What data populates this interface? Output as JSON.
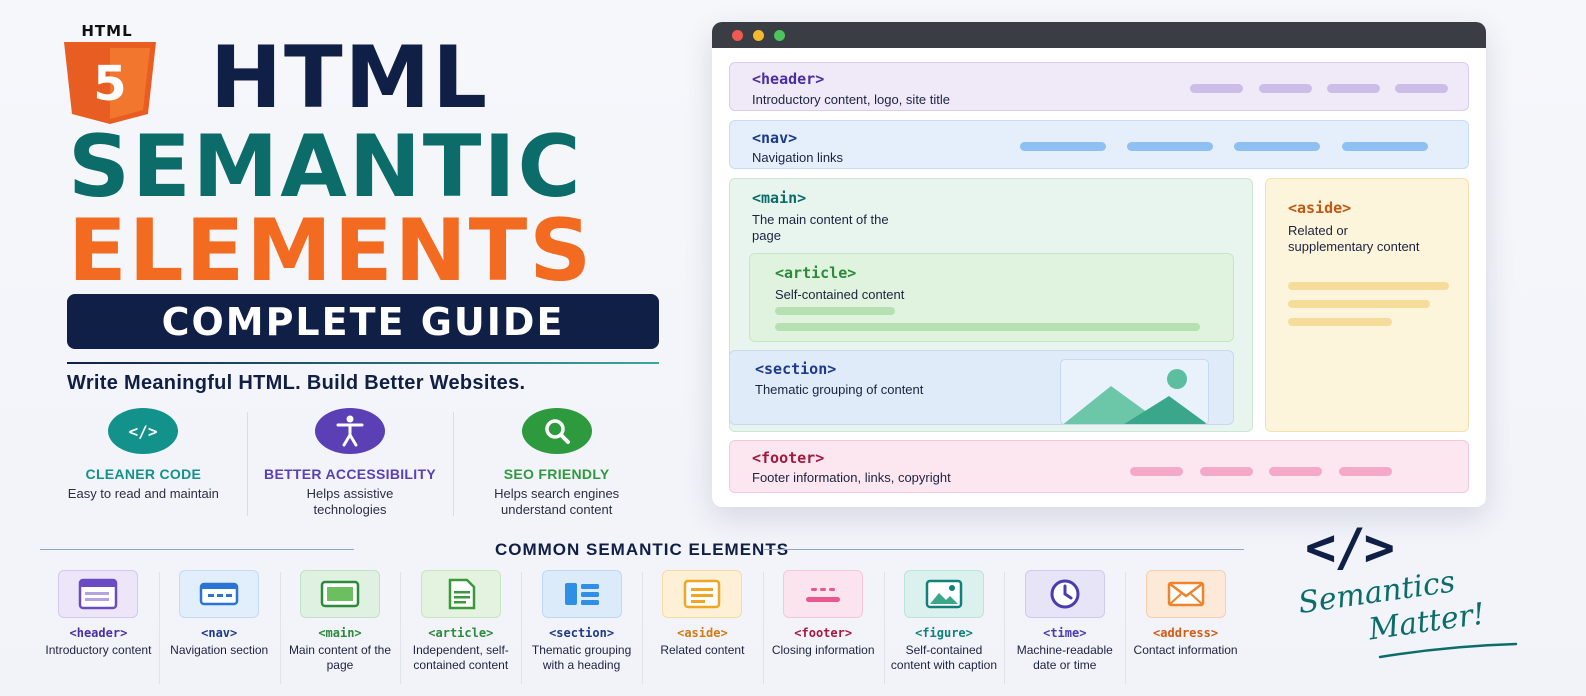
{
  "hero": {
    "logo_word": "HTML",
    "logo_number": "5",
    "title_line1": "HTML",
    "title_line2": "SEMANTIC",
    "title_line3": "ELEMENTS",
    "subtitle": "COMPLETE GUIDE",
    "tagline": "Write Meaningful HTML. Build Better Websites."
  },
  "colors": {
    "navy": "#0f1f45",
    "teal": "#0c6c6a",
    "orange": "#f36b21"
  },
  "benefits": [
    {
      "icon": "code-icon",
      "title": "CLEANER CODE",
      "desc": "Easy to read and maintain",
      "color": "#12928a"
    },
    {
      "icon": "accessibility-icon",
      "title": "BETTER ACCESSIBILITY",
      "desc": "Helps assistive technologies",
      "color": "#5a3fb5"
    },
    {
      "icon": "search-icon",
      "title": "SEO FRIENDLY",
      "desc": "Helps search engines understand content",
      "color": "#2e9a3e"
    }
  ],
  "browser": {
    "header": {
      "tag": "<header>",
      "desc": "Introductory content, logo, site title"
    },
    "nav": {
      "tag": "<nav>",
      "desc": "Navigation links"
    },
    "main": {
      "tag": "<main>",
      "desc": "The main content of the page"
    },
    "article": {
      "tag": "<article>",
      "desc": "Self-contained content"
    },
    "section": {
      "tag": "<section>",
      "desc": "Thematic grouping of content"
    },
    "aside": {
      "tag": "<aside>",
      "desc": "Related or supplementary content"
    },
    "footer": {
      "tag": "<footer>",
      "desc": "Footer information, links, copyright"
    }
  },
  "common": {
    "title": "COMMON SEMANTIC ELEMENTS",
    "items": [
      {
        "tag": "<header>",
        "desc": "Introductory content",
        "icon": "header-icon",
        "color": "#6a4bc4"
      },
      {
        "tag": "<nav>",
        "desc": "Navigation section",
        "icon": "nav-icon",
        "color": "#2a74d6"
      },
      {
        "tag": "<main>",
        "desc": "Main content of the page",
        "icon": "main-icon",
        "color": "#2c8a3a"
      },
      {
        "tag": "<article>",
        "desc": "Independent, self-contained content",
        "icon": "article-icon",
        "color": "#3a9a3a"
      },
      {
        "tag": "<section>",
        "desc": "Thematic grouping with a heading",
        "icon": "section-icon",
        "color": "#1e3a8a"
      },
      {
        "tag": "<aside>",
        "desc": "Related content",
        "icon": "aside-icon",
        "color": "#d47a12"
      },
      {
        "tag": "<footer>",
        "desc": "Closing information",
        "icon": "footer-icon",
        "color": "#b0244f"
      },
      {
        "tag": "<figure>",
        "desc": "Self-contained content with caption",
        "icon": "figure-icon",
        "color": "#12807a"
      },
      {
        "tag": "<time>",
        "desc": "Machine-readable date or time",
        "icon": "clock-icon",
        "color": "#4b3bb0"
      },
      {
        "tag": "<address>",
        "desc": "Contact information",
        "icon": "envelope-icon",
        "color": "#d65a12"
      }
    ]
  },
  "signature": {
    "code": "</>",
    "line1": "Semantics",
    "line2": "Matter!"
  }
}
